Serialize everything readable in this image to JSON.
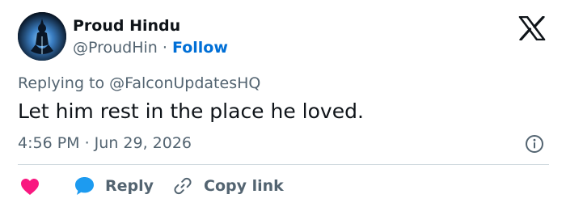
{
  "author": {
    "display_name": "Proud Hindu",
    "handle": "@ProudHin",
    "separator": "·",
    "follow_label": "Follow"
  },
  "tweet": {
    "replying_prefix": "Replying to",
    "replying_to": "@FalconUpdatesHQ",
    "text": "Let him rest in the place he loved.",
    "timestamp": "4:56 PM · Jun 29, 2026"
  },
  "actions": {
    "reply_label": "Reply",
    "copy_link_label": "Copy link"
  },
  "icons": {
    "platform_logo": "x-logo-icon",
    "info": "info-icon",
    "like": "heart-icon",
    "reply": "reply-bubble-icon",
    "copy_link": "link-icon"
  },
  "colors": {
    "text_primary": "#0f1419",
    "text_secondary": "#536471",
    "follow_link": "#006fd6",
    "heart": "#f91880",
    "reply_bubble": "#1d9bf0",
    "divider": "#cfd9de"
  }
}
